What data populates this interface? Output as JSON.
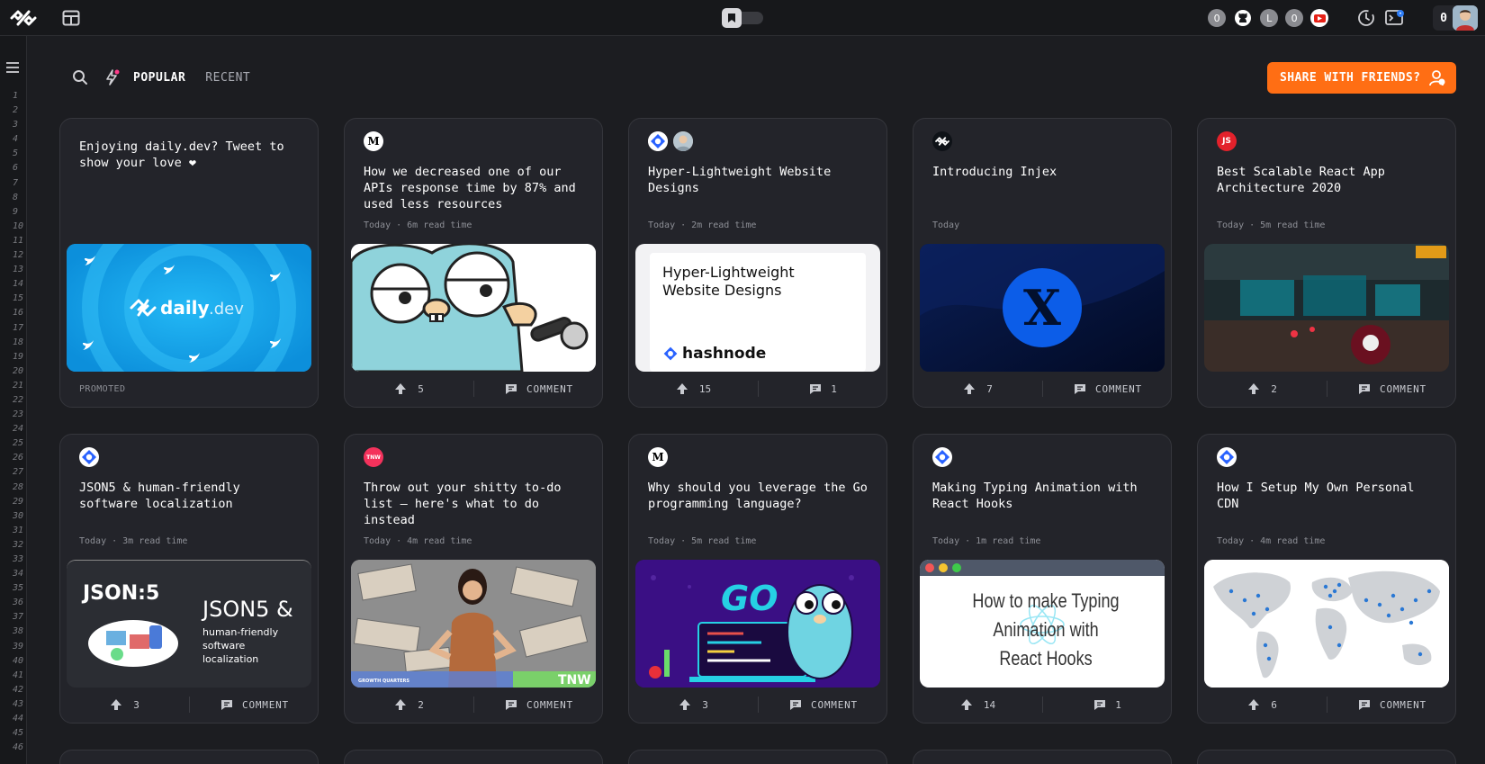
{
  "topbar": {
    "badges": [
      "0",
      "L",
      "0"
    ],
    "reputation": "0"
  },
  "gutter": {
    "line_numbers": [
      "1",
      "2",
      "3",
      "4",
      "5",
      "6",
      "7",
      "8",
      "9",
      "10",
      "11",
      "12",
      "13",
      "14",
      "15",
      "16",
      "17",
      "18",
      "19",
      "20",
      "21",
      "22",
      "23",
      "24",
      "25",
      "26",
      "27",
      "28",
      "29",
      "30",
      "31",
      "32",
      "33",
      "34",
      "35",
      "36",
      "37",
      "38",
      "39",
      "40",
      "41",
      "42",
      "43",
      "44",
      "45",
      "46"
    ]
  },
  "header": {
    "tabs": [
      {
        "label": "POPULAR",
        "active": true
      },
      {
        "label": "RECENT",
        "active": false
      }
    ],
    "share_label": "SHARE WITH FRIENDS?"
  },
  "colors": {
    "background": "#1c1d21",
    "card": "#23242a",
    "accent": "#ff6e14"
  },
  "cards": [
    {
      "kind": "promo",
      "title": "Enjoying daily.dev? Tweet to show your love ❤",
      "promoted": "PROMOTED",
      "image_text": "daily",
      "image_text2": ".dev"
    },
    {
      "source": "M",
      "title": "How we decreased one of our APIs response time by 87% and used less resources",
      "meta": "Today · 6m read time",
      "upvotes": "5",
      "comments": "COMMENT"
    },
    {
      "source": "hashnode-icon",
      "title": "Hyper-Lightweight Website Designs",
      "meta": "Today · 2m read time",
      "upvotes": "15",
      "comments": "1",
      "image_title": "Hyper-Lightweight Website Designs",
      "image_brand": "hashnode"
    },
    {
      "source": "dailydev-icon",
      "title": "Introducing Injex",
      "meta": "Today",
      "upvotes": "7",
      "comments": "COMMENT",
      "image_letter": "X"
    },
    {
      "source": "JS",
      "title": "Best Scalable React App Architecture 2020",
      "meta": "Today · 5m read time",
      "upvotes": "2",
      "comments": "COMMENT"
    },
    {
      "source": "hashnode-icon",
      "title": "JSON5 & human-friendly software localization",
      "meta": "Today · 3m read time",
      "upvotes": "3",
      "comments": "COMMENT",
      "image_logo": "JSON:5",
      "image_head": "JSON5 &",
      "image_sub": "human-friendly software localization"
    },
    {
      "source": "TNW",
      "title": "Throw out your shitty to-do list — here's what to do instead",
      "meta": "Today · 4m read time",
      "upvotes": "2",
      "comments": "COMMENT",
      "image_tag": "GROWTH QUARTERS",
      "image_brand": "TNW"
    },
    {
      "source": "M",
      "title": "Why should you leverage the Go programming language?",
      "meta": "Today · 5m read time",
      "upvotes": "3",
      "comments": "COMMENT",
      "image_word": "GO"
    },
    {
      "source": "hashnode-icon",
      "title": "Making Typing Animation with React Hooks",
      "meta": "Today · 1m read time",
      "upvotes": "14",
      "comments": "1",
      "image_text": "How to make Typing Animation with React Hooks"
    },
    {
      "source": "hashnode-icon",
      "title": "How I Setup My Own Personal CDN",
      "meta": "Today · 4m read time",
      "upvotes": "6",
      "comments": "COMMENT"
    }
  ]
}
